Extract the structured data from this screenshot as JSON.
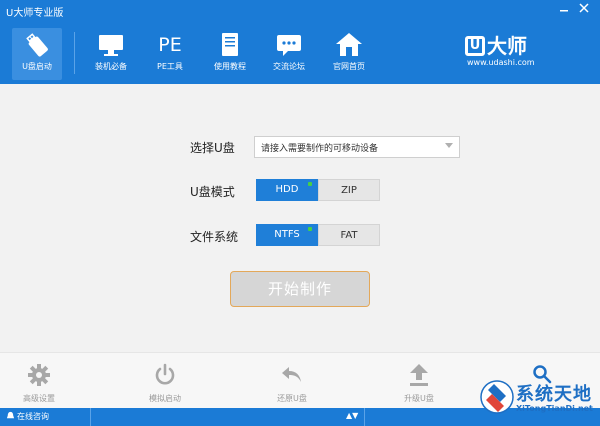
{
  "window": {
    "title": "U大师专业版"
  },
  "nav": {
    "items": [
      {
        "label": "U盘启动",
        "icon": "usb-drive-icon",
        "active": true
      },
      {
        "label": "装机必备",
        "icon": "monitor-icon"
      },
      {
        "label": "PE工具",
        "icon": "pe-text-icon",
        "glyph": "PE"
      },
      {
        "label": "使用教程",
        "icon": "book-icon"
      },
      {
        "label": "交流论坛",
        "icon": "chat-bubble-icon"
      },
      {
        "label": "官网首页",
        "icon": "home-icon"
      }
    ]
  },
  "brand": {
    "logo_letter": "U",
    "logo_text": "大师",
    "url": "www.udashi.com"
  },
  "form": {
    "usb_label": "选择U盘",
    "usb_select_value": "请接入需要制作的可移动设备",
    "mode_label": "U盘模式",
    "mode_options": [
      "HDD",
      "ZIP"
    ],
    "mode_selected": "HDD",
    "fs_label": "文件系统",
    "fs_options": [
      "NTFS",
      "FAT"
    ],
    "fs_selected": "NTFS",
    "start_button": "开始制作"
  },
  "toolbar": {
    "items": [
      {
        "label": "高级设置",
        "icon": "gear-icon"
      },
      {
        "label": "模拟启动",
        "icon": "power-icon"
      },
      {
        "label": "还原U盘",
        "icon": "undo-icon"
      },
      {
        "label": "升级U盘",
        "icon": "upload-icon"
      }
    ]
  },
  "status": {
    "online_help": "在线咨询",
    "arrows": "▲▼"
  },
  "watermark": {
    "title": "系统天地",
    "url": "XiTongTianDi.net"
  },
  "colors": {
    "brand_blue": "#1b7bd6",
    "active_green": "#46d046",
    "select_blue": "#1f7fd8"
  }
}
